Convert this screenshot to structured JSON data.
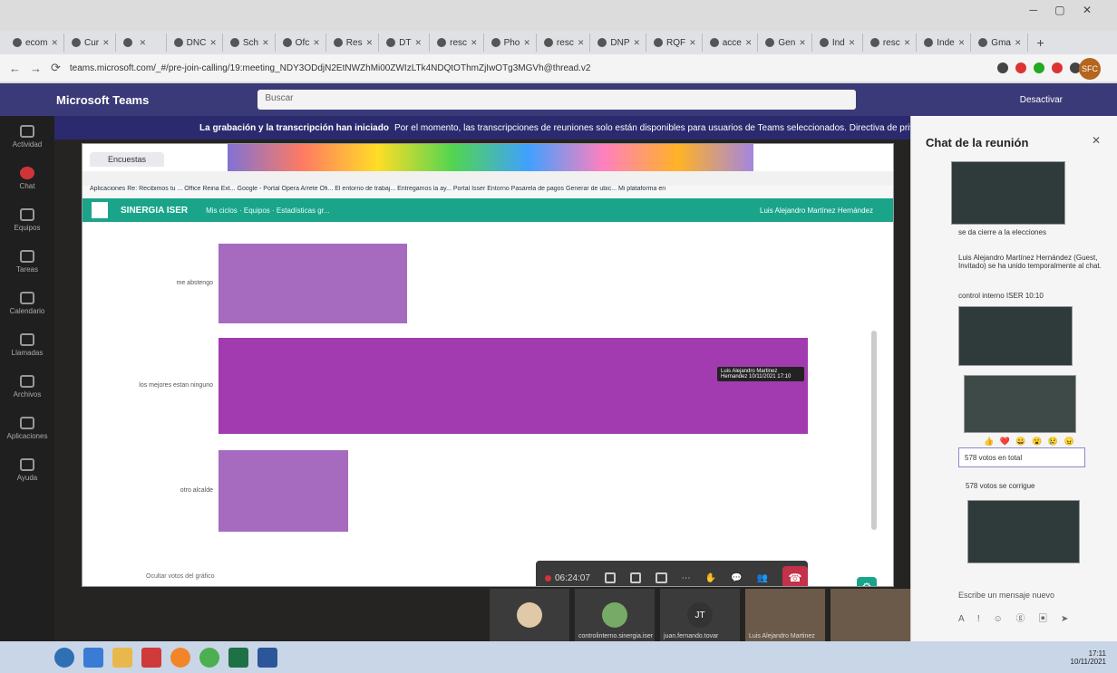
{
  "browser": {
    "tabs": [
      "ecom",
      "Cur",
      "",
      "DNC",
      "Sch",
      "Ofc",
      "Res",
      "DT",
      "resc",
      "Pho",
      "resc",
      "DNP",
      "RQF",
      "acce",
      "Gen",
      "Ind",
      "resc",
      "Inde",
      "Gma"
    ],
    "url": "teams.microsoft.com/_#/pre-join-calling/19:meeting_NDY3ODdjN2EtNWZhMi00ZWIzLTk4NDQtOThmZjIwOTg3MGVh@thread.v2",
    "profile_initials": "SFC"
  },
  "teams": {
    "app_title": "Microsoft Teams",
    "search_placeholder": "Buscar",
    "user_name": "Desactivar",
    "rail": [
      "Actividad",
      "Chat",
      "Equipos",
      "Tareas",
      "Calendario",
      "Llamadas",
      "Archivos",
      "Aplicaciones",
      "Ayuda"
    ]
  },
  "banner": {
    "bold": "La grabación y la transcripción han iniciado",
    "rest": "Por el momento, las transcripciones de reuniones solo están disponibles para usuarios de Teams seleccionados. Directiva de privacidad"
  },
  "shared": {
    "tab_label": "Encuestas",
    "bookmarks": "Aplicaciones  Re: Recibimos tu ...  Office Reina Ext...  Google - Portal  Opera Arrete Ofi...  El entorno de trabaj...  Entregamos la ay...  Portal Isser  Entorno  Pasarela de pagos  Generar de ubic...  Mi plataforma en",
    "brand": "SINERGIA ISER",
    "menu": "Mis ciclos  ·  Equipos  ·  Estadísticas gr...",
    "user": "Luis Alejandro Martínez Hernández"
  },
  "chart_data": {
    "type": "bar",
    "orientation": "horizontal",
    "categories": [
      "me abstengo",
      "los mejores estan ninguno",
      "otro alcalde"
    ],
    "values": [
      32,
      100,
      22
    ],
    "tooltip": "Luis Alejandro Martinez Hernandez\n10/11/2021 17:10",
    "footer": "Ocultar votos del gráfico"
  },
  "call": {
    "timer": "06:24:07"
  },
  "participants": [
    {
      "initials": "",
      "name": ""
    },
    {
      "initials": "",
      "name": "controlinterno.sinergia.iser"
    },
    {
      "initials": "JT",
      "name": "juan.fernando.tovar"
    },
    {
      "initials": "",
      "name": "Luis Alejandro Martinez"
    },
    {
      "initials": "",
      "name": ""
    }
  ],
  "chat": {
    "title": "Chat de la reunión",
    "msg1": "se da cierre a la elecciones",
    "msg2": "Luis Alejandro Martínez Hernández (Guest, Invitado) se ha unido temporalmente al chat.",
    "msg3": "control interno ISER   10:10",
    "reactions": "👍 ❤️ 😄 😮 😢 😠",
    "votes_total": "578 votos en total",
    "votes_correct": "578 votos se corrigue",
    "compose": "Escribe un mensaje nuevo"
  },
  "taskbar": {
    "time": "17:11",
    "date": "10/11/2021"
  },
  "colors": {
    "teams_purple": "#3b3a78",
    "bar_purple": "#9b59b6",
    "sinergia_green": "#1aa48a",
    "hangup_red": "#c4314b"
  }
}
